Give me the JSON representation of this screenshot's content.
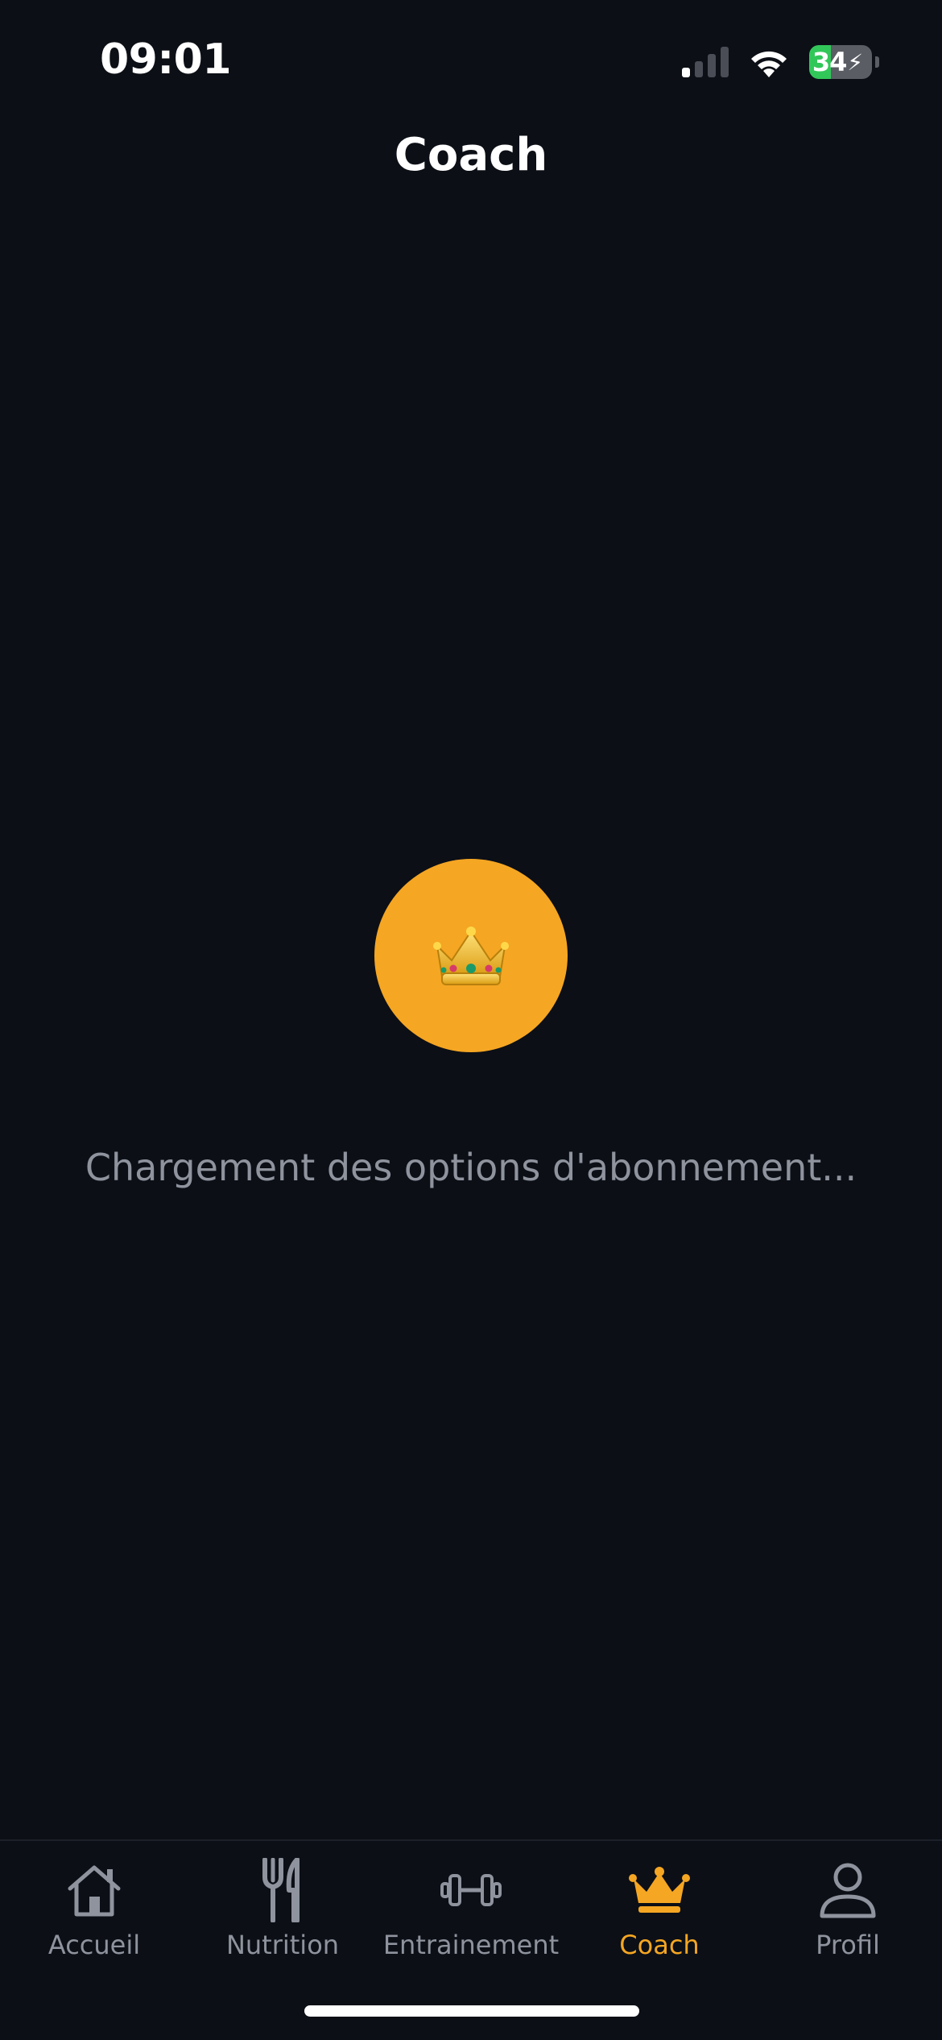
{
  "status_bar": {
    "time": "09:01",
    "battery_level": "34",
    "battery_percent": 34
  },
  "header": {
    "title": "Coach"
  },
  "loading": {
    "icon": "crown-icon",
    "message": "Chargement des options d'abonnement..."
  },
  "tab_bar": {
    "active": "Coach",
    "tabs": [
      {
        "label": "Accueil",
        "icon": "home-icon"
      },
      {
        "label": "Nutrition",
        "icon": "fork-knife-icon"
      },
      {
        "label": "Entrainement",
        "icon": "dumbbell-icon"
      },
      {
        "label": "Coach",
        "icon": "crown-icon"
      },
      {
        "label": "Profil",
        "icon": "person-icon"
      }
    ]
  },
  "colors": {
    "background": "#0c0f16",
    "accent": "#f5a623",
    "inactive": "#8e939d",
    "battery_green": "#32c759"
  }
}
